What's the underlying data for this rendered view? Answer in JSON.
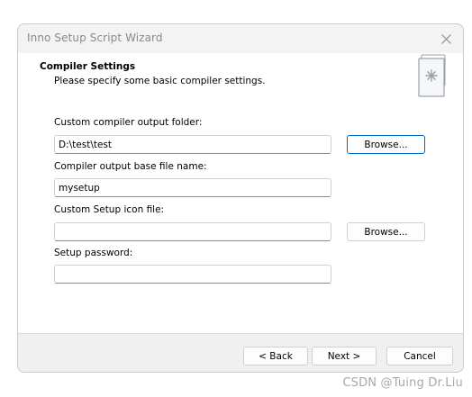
{
  "window": {
    "title": "Inno Setup Script Wizard",
    "close_icon": "close-icon"
  },
  "header": {
    "title": "Compiler Settings",
    "subtitle": "Please specify some basic compiler settings.",
    "icon": "wizard-document-icon"
  },
  "form": {
    "output_folder": {
      "label": "Custom compiler output folder:",
      "value": "D:\\test\\test",
      "browse_label": "Browse..."
    },
    "base_filename": {
      "label": "Compiler output base file name:",
      "value": "mysetup"
    },
    "icon_file": {
      "label": "Custom Setup icon file:",
      "value": "",
      "browse_label": "Browse..."
    },
    "password": {
      "label": "Setup password:",
      "value": ""
    }
  },
  "footer": {
    "back_label": "< Back",
    "next_label": "Next >",
    "cancel_label": "Cancel"
  },
  "watermark": "CSDN @Tuing Dr.Liu",
  "colors": {
    "accent": "#0067c0",
    "dialog_bg": "#f3f3f3",
    "content_bg": "#ffffff",
    "title_text": "#8a8a8a"
  }
}
